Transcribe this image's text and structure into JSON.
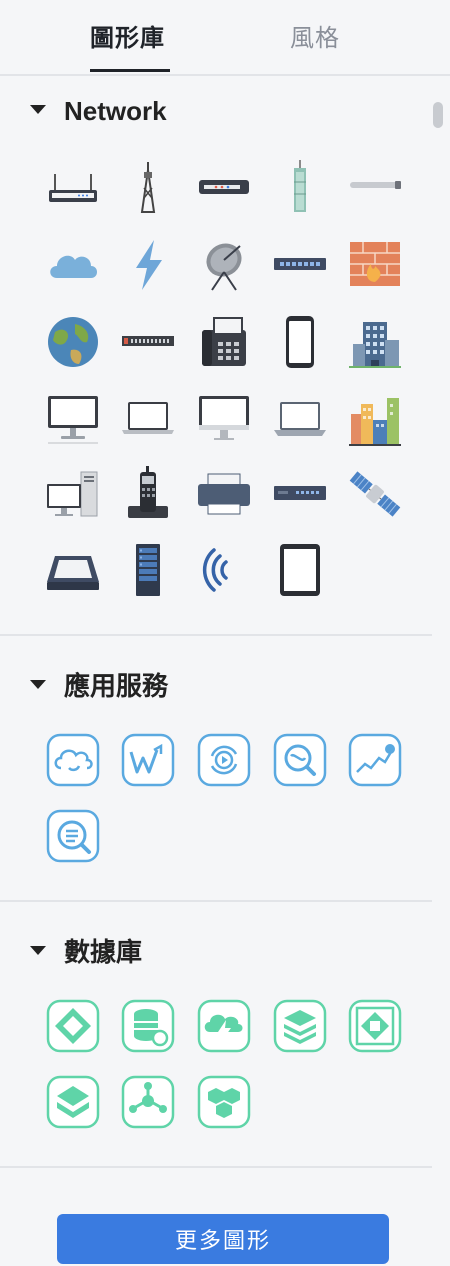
{
  "tabs": {
    "shapes_label": "圖形庫",
    "style_label": "風格"
  },
  "sections": {
    "network": {
      "title": "Network",
      "icons": [
        "wifi-router-icon",
        "radio-tower-icon",
        "modem-icon",
        "skyscraper-tower-icon",
        "cable-icon",
        "cloud-icon",
        "lightning-icon",
        "satellite-dish-icon",
        "network-switch-icon",
        "firewall-icon",
        "globe-icon",
        "patch-panel-icon",
        "fax-machine-icon",
        "smartphone-icon",
        "office-building-icon",
        "desktop-monitor-icon",
        "laptop-icon",
        "imac-icon",
        "laptop-open-icon",
        "city-buildings-icon",
        "desktop-pc-icon",
        "cordless-phone-icon",
        "printer-icon",
        "router-rack-icon",
        "satellite-icon",
        "scanner-icon",
        "server-rack-icon",
        "wireless-signal-icon",
        "tablet-icon"
      ]
    },
    "app_services": {
      "title": "應用服務",
      "icons": [
        "cloud-sync-icon",
        "word-service-icon",
        "media-refresh-icon",
        "search-analytics-icon",
        "trend-chart-icon",
        "query-search-icon"
      ]
    },
    "database": {
      "title": "數據庫",
      "icons": [
        "db-diamond-icon",
        "db-config-icon",
        "cloud-function-icon",
        "db-stack-icon",
        "db-frame-icon",
        "db-layer-icon",
        "db-cluster-icon",
        "db-hexagon-icon"
      ]
    }
  },
  "colors": {
    "accent": "#3a7be0",
    "app_service_stroke": "#5aa9e0",
    "database_stroke": "#5fd4a8"
  },
  "footer": {
    "more_shapes_label": "更多圖形"
  }
}
